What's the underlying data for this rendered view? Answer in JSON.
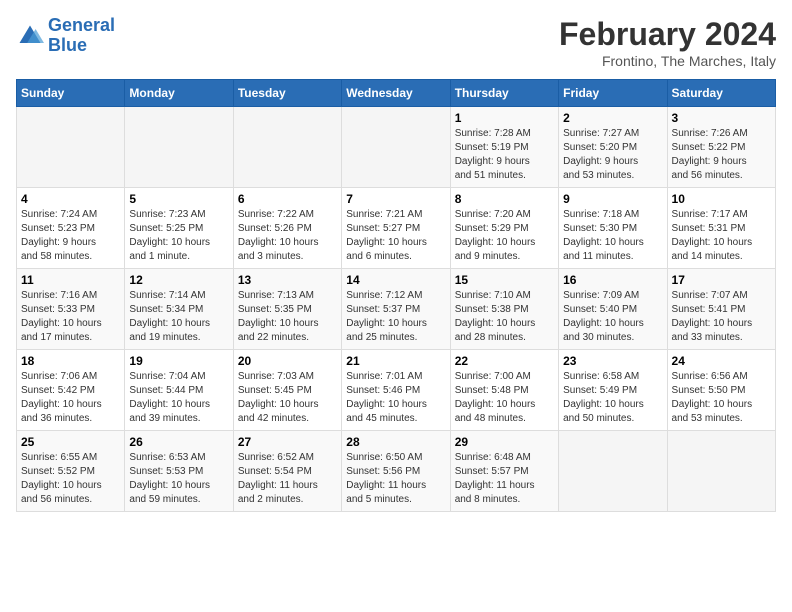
{
  "logo": {
    "line1": "General",
    "line2": "Blue"
  },
  "title": "February 2024",
  "subtitle": "Frontino, The Marches, Italy",
  "weekdays": [
    "Sunday",
    "Monday",
    "Tuesday",
    "Wednesday",
    "Thursday",
    "Friday",
    "Saturday"
  ],
  "weeks": [
    [
      {
        "day": "",
        "info": ""
      },
      {
        "day": "",
        "info": ""
      },
      {
        "day": "",
        "info": ""
      },
      {
        "day": "",
        "info": ""
      },
      {
        "day": "1",
        "info": "Sunrise: 7:28 AM\nSunset: 5:19 PM\nDaylight: 9 hours\nand 51 minutes."
      },
      {
        "day": "2",
        "info": "Sunrise: 7:27 AM\nSunset: 5:20 PM\nDaylight: 9 hours\nand 53 minutes."
      },
      {
        "day": "3",
        "info": "Sunrise: 7:26 AM\nSunset: 5:22 PM\nDaylight: 9 hours\nand 56 minutes."
      }
    ],
    [
      {
        "day": "4",
        "info": "Sunrise: 7:24 AM\nSunset: 5:23 PM\nDaylight: 9 hours\nand 58 minutes."
      },
      {
        "day": "5",
        "info": "Sunrise: 7:23 AM\nSunset: 5:25 PM\nDaylight: 10 hours\nand 1 minute."
      },
      {
        "day": "6",
        "info": "Sunrise: 7:22 AM\nSunset: 5:26 PM\nDaylight: 10 hours\nand 3 minutes."
      },
      {
        "day": "7",
        "info": "Sunrise: 7:21 AM\nSunset: 5:27 PM\nDaylight: 10 hours\nand 6 minutes."
      },
      {
        "day": "8",
        "info": "Sunrise: 7:20 AM\nSunset: 5:29 PM\nDaylight: 10 hours\nand 9 minutes."
      },
      {
        "day": "9",
        "info": "Sunrise: 7:18 AM\nSunset: 5:30 PM\nDaylight: 10 hours\nand 11 minutes."
      },
      {
        "day": "10",
        "info": "Sunrise: 7:17 AM\nSunset: 5:31 PM\nDaylight: 10 hours\nand 14 minutes."
      }
    ],
    [
      {
        "day": "11",
        "info": "Sunrise: 7:16 AM\nSunset: 5:33 PM\nDaylight: 10 hours\nand 17 minutes."
      },
      {
        "day": "12",
        "info": "Sunrise: 7:14 AM\nSunset: 5:34 PM\nDaylight: 10 hours\nand 19 minutes."
      },
      {
        "day": "13",
        "info": "Sunrise: 7:13 AM\nSunset: 5:35 PM\nDaylight: 10 hours\nand 22 minutes."
      },
      {
        "day": "14",
        "info": "Sunrise: 7:12 AM\nSunset: 5:37 PM\nDaylight: 10 hours\nand 25 minutes."
      },
      {
        "day": "15",
        "info": "Sunrise: 7:10 AM\nSunset: 5:38 PM\nDaylight: 10 hours\nand 28 minutes."
      },
      {
        "day": "16",
        "info": "Sunrise: 7:09 AM\nSunset: 5:40 PM\nDaylight: 10 hours\nand 30 minutes."
      },
      {
        "day": "17",
        "info": "Sunrise: 7:07 AM\nSunset: 5:41 PM\nDaylight: 10 hours\nand 33 minutes."
      }
    ],
    [
      {
        "day": "18",
        "info": "Sunrise: 7:06 AM\nSunset: 5:42 PM\nDaylight: 10 hours\nand 36 minutes."
      },
      {
        "day": "19",
        "info": "Sunrise: 7:04 AM\nSunset: 5:44 PM\nDaylight: 10 hours\nand 39 minutes."
      },
      {
        "day": "20",
        "info": "Sunrise: 7:03 AM\nSunset: 5:45 PM\nDaylight: 10 hours\nand 42 minutes."
      },
      {
        "day": "21",
        "info": "Sunrise: 7:01 AM\nSunset: 5:46 PM\nDaylight: 10 hours\nand 45 minutes."
      },
      {
        "day": "22",
        "info": "Sunrise: 7:00 AM\nSunset: 5:48 PM\nDaylight: 10 hours\nand 48 minutes."
      },
      {
        "day": "23",
        "info": "Sunrise: 6:58 AM\nSunset: 5:49 PM\nDaylight: 10 hours\nand 50 minutes."
      },
      {
        "day": "24",
        "info": "Sunrise: 6:56 AM\nSunset: 5:50 PM\nDaylight: 10 hours\nand 53 minutes."
      }
    ],
    [
      {
        "day": "25",
        "info": "Sunrise: 6:55 AM\nSunset: 5:52 PM\nDaylight: 10 hours\nand 56 minutes."
      },
      {
        "day": "26",
        "info": "Sunrise: 6:53 AM\nSunset: 5:53 PM\nDaylight: 10 hours\nand 59 minutes."
      },
      {
        "day": "27",
        "info": "Sunrise: 6:52 AM\nSunset: 5:54 PM\nDaylight: 11 hours\nand 2 minutes."
      },
      {
        "day": "28",
        "info": "Sunrise: 6:50 AM\nSunset: 5:56 PM\nDaylight: 11 hours\nand 5 minutes."
      },
      {
        "day": "29",
        "info": "Sunrise: 6:48 AM\nSunset: 5:57 PM\nDaylight: 11 hours\nand 8 minutes."
      },
      {
        "day": "",
        "info": ""
      },
      {
        "day": "",
        "info": ""
      }
    ]
  ]
}
